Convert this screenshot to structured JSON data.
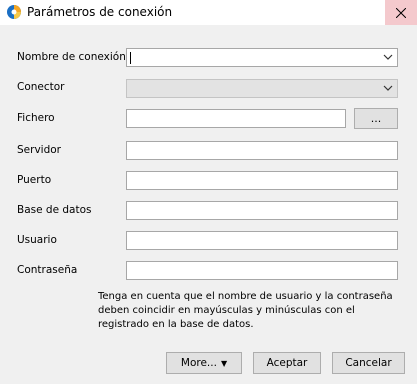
{
  "window": {
    "title": "Parámetros de conexión",
    "close_icon": "close-icon"
  },
  "form": {
    "nombre_label": "Nombre de conexión",
    "nombre_value": "",
    "conector_label": "Conector",
    "conector_value": "",
    "fichero_label": "Fichero",
    "fichero_value": "",
    "browse_label": "...",
    "servidor_label": "Servidor",
    "servidor_value": "",
    "puerto_label": "Puerto",
    "puerto_value": "",
    "basedatos_label": "Base de datos",
    "basedatos_value": "",
    "usuario_label": "Usuario",
    "usuario_value": "",
    "contrasena_label": "Contraseña",
    "contrasena_value": ""
  },
  "note": "Tenga en cuenta que el nombre de usuario y la contraseña deben coincidir en mayúsculas y minúsculas con el registrado en la base de datos.",
  "buttons": {
    "more": "More...",
    "more_arrow": "▼",
    "ok": "Aceptar",
    "cancel": "Cancelar"
  },
  "colors": {
    "close_bg": "#f4c9cd",
    "dialog_bg": "#f0f0f0"
  }
}
